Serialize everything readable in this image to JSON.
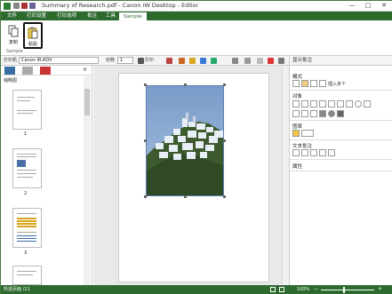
{
  "window": {
    "title": "Summary of Research.pdf - Canon iW Desktop - Editor",
    "minimize": "—",
    "maximize": "□",
    "close": "✕"
  },
  "tabs": [
    {
      "label": "文件"
    },
    {
      "label": "打印设置"
    },
    {
      "label": "打印选项"
    },
    {
      "label": "批注"
    },
    {
      "label": "工具"
    },
    {
      "label": "Sample"
    }
  ],
  "ribbon": {
    "copy_label": "复制",
    "paste_label": "粘贴",
    "group_label": "Sample"
  },
  "toolbar": {
    "printer_label": "打印机",
    "printer_value": "Canon iR-ADV",
    "copies_label": "份数",
    "copies_value": "1",
    "print_label": "打印",
    "show_annotation_label": "显示批注"
  },
  "left_pane": {
    "thumbnails_label": "缩略图",
    "pages": [
      "1",
      "2",
      "3"
    ]
  },
  "right_pane": {
    "mode_label": "模式",
    "insert_label": "插入多个",
    "object_label": "对象",
    "stamp_label": "图章",
    "text_annotation_label": "文本批注",
    "properties_label": "属性"
  },
  "status": {
    "page_info": "所选页面 /11",
    "zoom": "100%"
  },
  "colors": {
    "brand_green": "#2d6a2e"
  }
}
